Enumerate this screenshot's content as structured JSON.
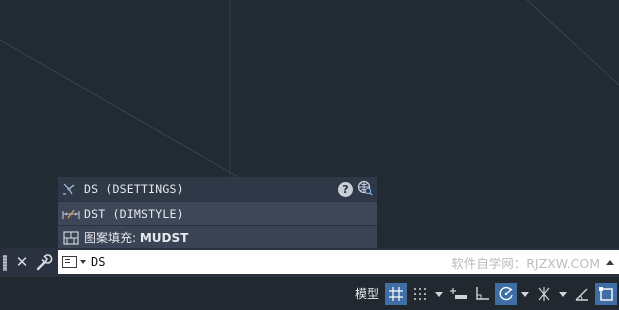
{
  "autocomplete": {
    "items": [
      {
        "label": "DS (DSETTINGS)",
        "icon": "dsettings-icon"
      },
      {
        "label": "DST (DIMSTYLE)",
        "icon": "dimstyle-icon"
      },
      {
        "label_prefix": "图案填充: ",
        "label_bold": "MUDST",
        "icon": "hatch-icon"
      }
    ],
    "help_symbol": "?"
  },
  "command_line": {
    "close_symbol": "✕",
    "input_value": "DS",
    "watermark": "软件自学网：RJZXW.COM"
  },
  "status_bar": {
    "model_label": "模型",
    "accent_color": "#3e6ea3"
  }
}
